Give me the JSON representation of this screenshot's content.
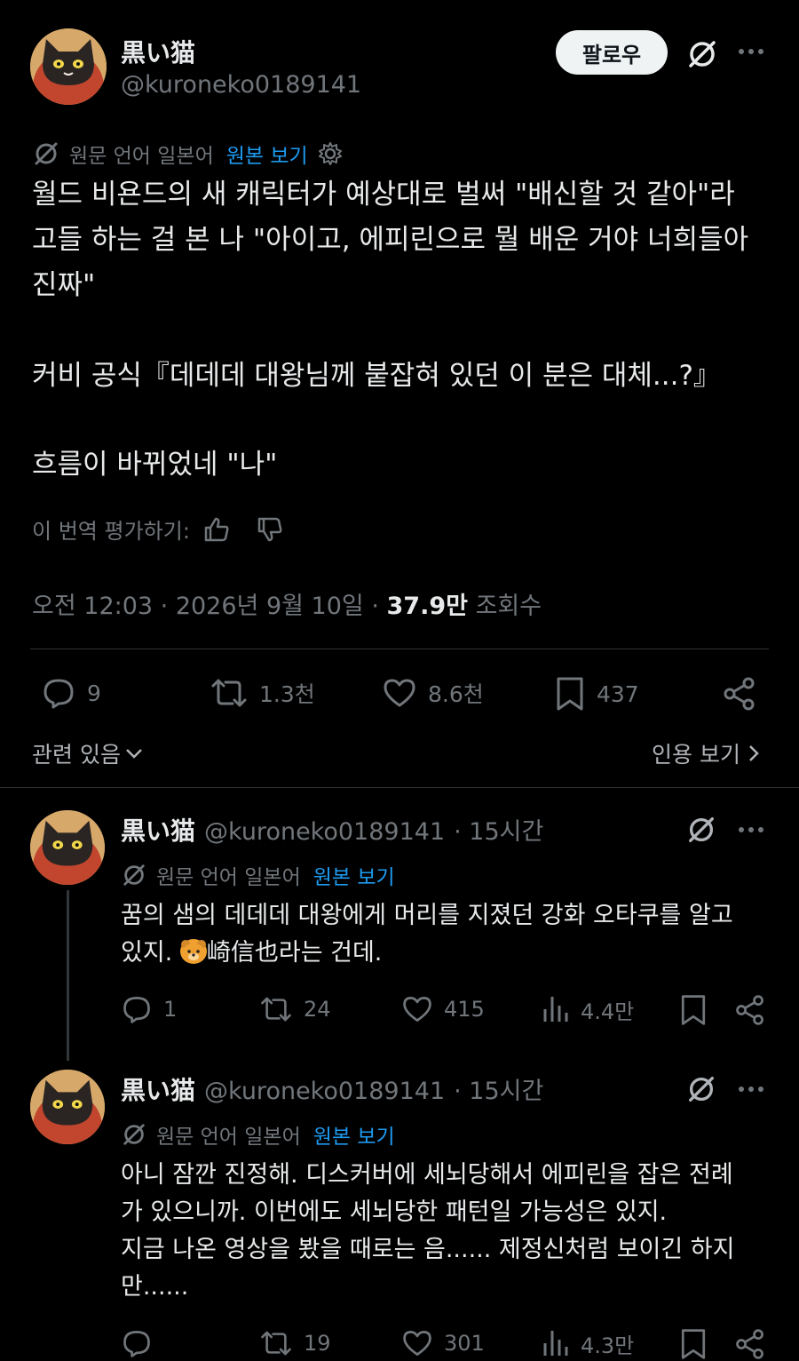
{
  "post": {
    "author_name": "黒い猫",
    "author_handle": "@kuroneko0189141",
    "follow_label": "팔로우",
    "more_icon": "more-icon",
    "translate": {
      "source_label": "원문 언어 일본어",
      "view_original": "원본 보기"
    },
    "paragraphs": [
      "월드 비욘드의 새 캐릭터가 예상대로 벌써 \"배신할 것 같아\"라\n고들 하는 걸 본 나 \"아이고, 에피린으로 뭘 배운 거야 너희들아\n진짜\"",
      "커비 공식『데데데 대왕님께 붙잡혀 있던 이 분은 대체...?』",
      "흐름이 바뀌었네 \"나\""
    ],
    "rate_label": "이 번역 평가하기:",
    "timestamp": "오전 12:03 · 2026년 9월 10일 ·",
    "views_count": "37.9만",
    "views_label": "조회수",
    "actions": {
      "replies": "9",
      "reposts": "1.3천",
      "likes": "8.6천",
      "bookmarks": "437"
    },
    "related_label": "관련 있음",
    "quotes_label": "인용 보기"
  },
  "replies": [
    {
      "author_name": "黒い猫",
      "author_handle": "@kuroneko0189141",
      "time": "· 15시간",
      "translate_source": "원문 언어 일본어",
      "view_original": "원본 보기",
      "text_a": "꿈의 샘의 데데데 대왕에게 머리를 지졌던 강화 오타쿠를 알고\n있지. ",
      "text_b": "崎信也라는 건데.",
      "emoji": "bear-emoji",
      "replies": "1",
      "reposts": "24",
      "likes": "415",
      "views": "4.4만"
    },
    {
      "author_name": "黒い猫",
      "author_handle": "@kuroneko0189141",
      "time": "· 15시간",
      "translate_source": "원문 언어 일본어",
      "view_original": "원본 보기",
      "text_a": "아니 잠깐 진정해. 디스커버에 세뇌당해서 에피린을 잡은 전례\n가 있으니까. 이번에도 세뇌당한 패턴일 가능성은 있지.\n지금 나온 영상을 봤을 때로는 음...... 제정신처럼 보이긴 하지\n만......",
      "replies": "",
      "reposts": "19",
      "likes": "301",
      "views": "4.3만"
    }
  ],
  "colors": {
    "background": "#000000",
    "text": "#e7e9ea",
    "muted": "#71767b",
    "link": "#1d9bf0",
    "divider": "#2f3336"
  }
}
